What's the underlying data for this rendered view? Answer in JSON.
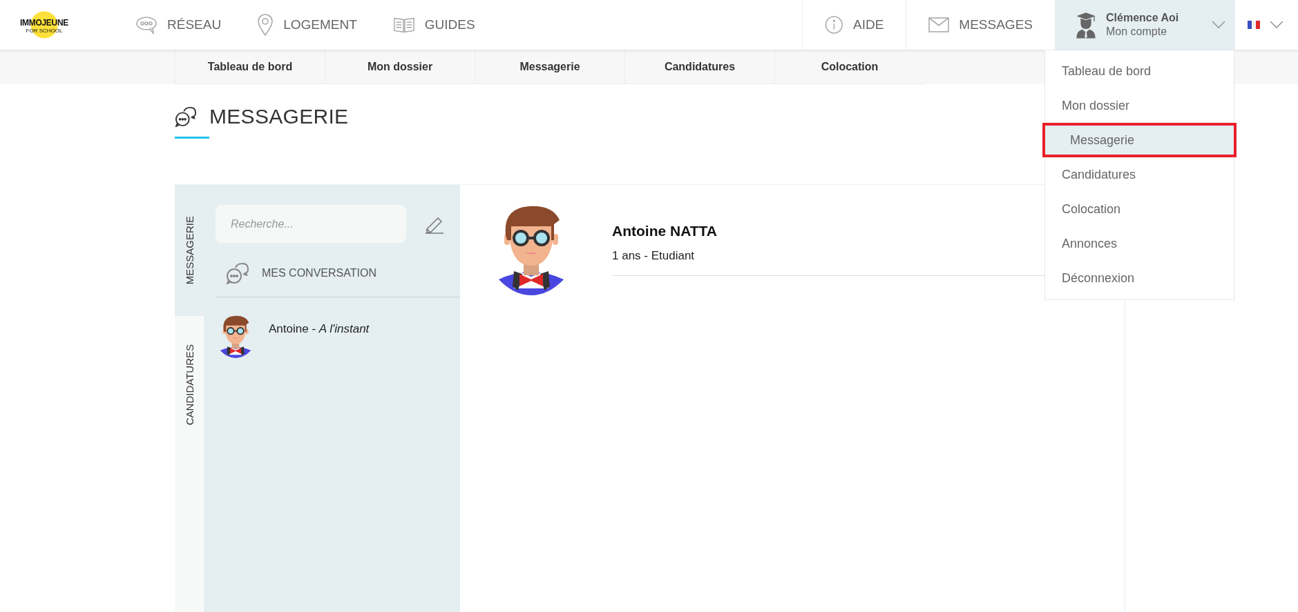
{
  "header": {
    "logo": {
      "text": "IMMOJEUNE",
      "subtext": "FOR SCHOOL"
    },
    "nav": [
      {
        "kind": "network",
        "label": "RÉSEAU"
      },
      {
        "kind": "housing",
        "label": "LOGEMENT"
      },
      {
        "kind": "guides",
        "label": "GUIDES"
      }
    ],
    "help": {
      "label": "AIDE"
    },
    "messages": {
      "label": "MESSAGES"
    },
    "account": {
      "name": "Clémence Aoi",
      "subtitle": "Mon compte",
      "expanded": true
    }
  },
  "subnav": [
    "Tableau de bord",
    "Mon dossier",
    "Messagerie",
    "Candidatures",
    "Colocation"
  ],
  "account_menu": [
    {
      "label": "Tableau de bord",
      "selected": false
    },
    {
      "label": "Mon dossier",
      "selected": false
    },
    {
      "label": "Messagerie",
      "selected": true
    },
    {
      "label": "Candidatures",
      "selected": false
    },
    {
      "label": "Colocation",
      "selected": false
    },
    {
      "label": "Annonces",
      "selected": false
    },
    {
      "label": "Déconnexion",
      "selected": false
    }
  ],
  "page_title": "MESSAGERIE",
  "side_tabs": [
    {
      "label": "MESSAGERIE",
      "selected": true
    },
    {
      "label": "CANDIDATURES",
      "selected": false
    }
  ],
  "search": {
    "placeholder": "Recherche..."
  },
  "conversations_heading": "MES CONVERSATION",
  "conversations": [
    {
      "text": "Antoine - *A l'instant*"
    }
  ],
  "profile": {
    "name": "Antoine NATTA",
    "details": "1 ans - Etudiant"
  }
}
